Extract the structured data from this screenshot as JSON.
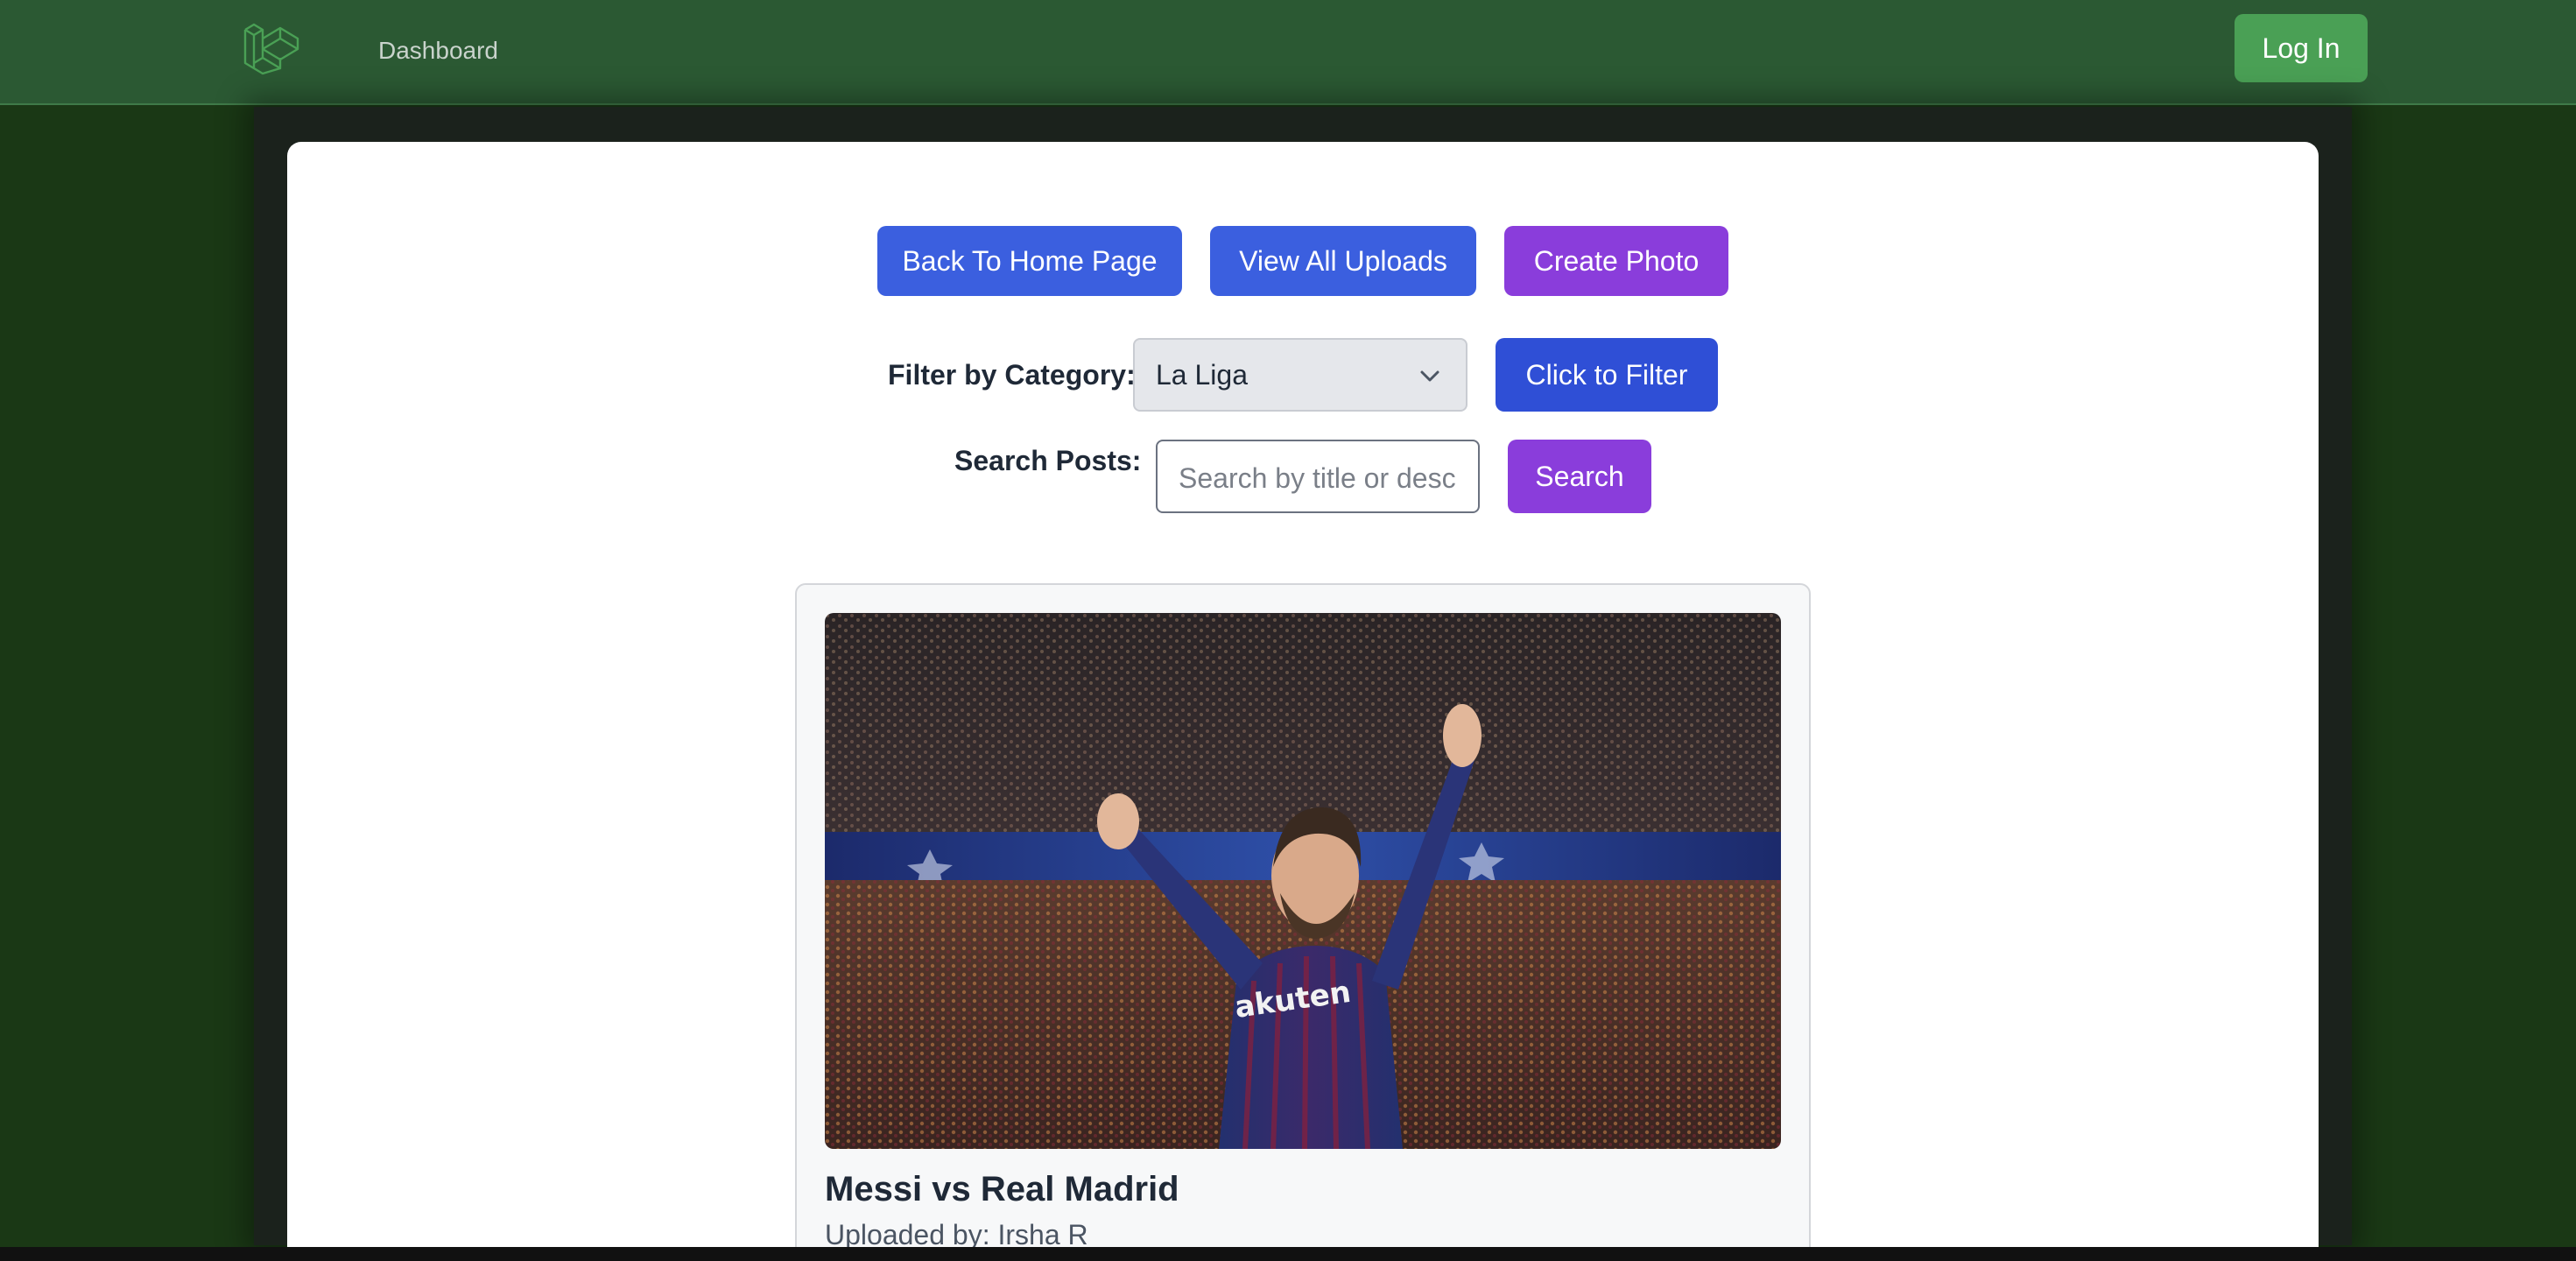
{
  "nav": {
    "logo_icon": "laravel-logo-icon",
    "dashboard_label": "Dashboard",
    "login_label": "Log In"
  },
  "actions": {
    "back_home_label": "Back To Home Page",
    "view_uploads_label": "View All Uploads",
    "create_photo_label": "Create Photo"
  },
  "filter": {
    "label": "Filter by Category:",
    "selected": "La Liga",
    "button_label": "Click to Filter"
  },
  "search": {
    "label": "Search Posts:",
    "placeholder": "Search by title or desc",
    "button_label": "Search"
  },
  "post": {
    "image_description_icon": "photo-icon",
    "title": "Messi vs Real Madrid",
    "uploaded_by": "Uploaded by: Irsha R"
  },
  "colors": {
    "nav_bg": "#2b5933",
    "page_bg": "#1a3815",
    "login_green": "#4aa055",
    "blue": "#3b5fdf",
    "purple": "#8a3ddb"
  }
}
